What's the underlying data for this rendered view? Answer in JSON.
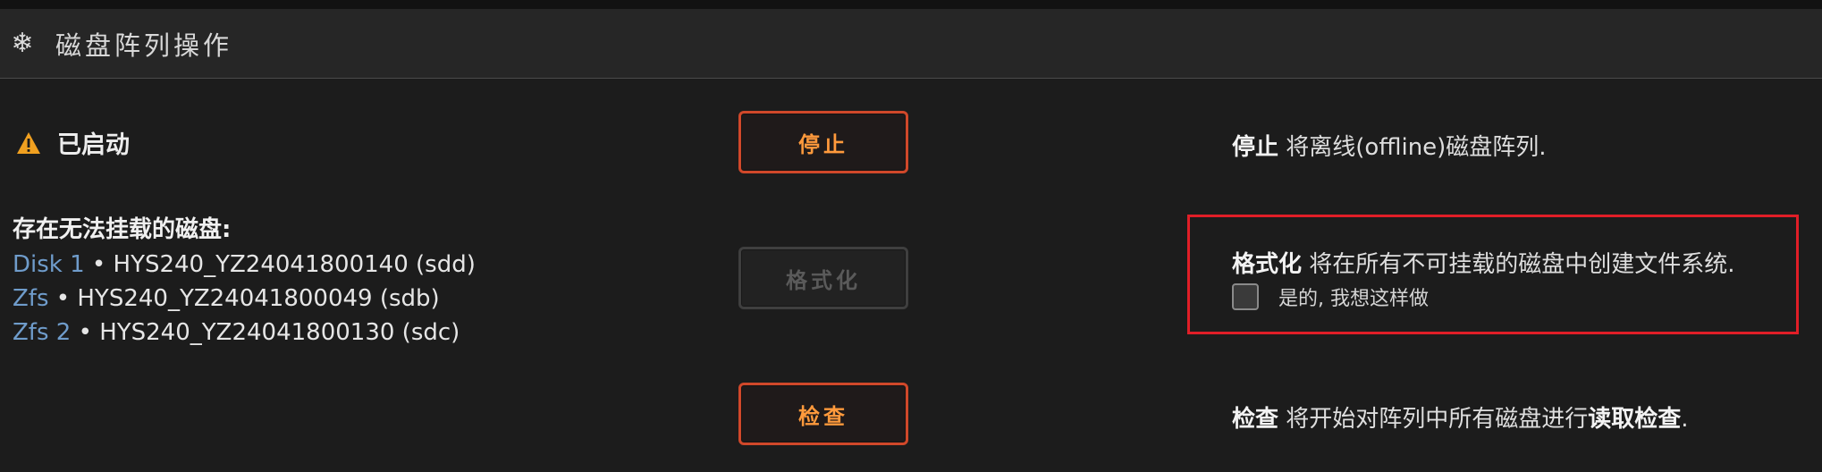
{
  "header": {
    "title": "磁盘阵列操作",
    "icon": "snowflake-icon"
  },
  "status": {
    "icon": "warning-icon",
    "text": "已启动",
    "icon_color": "#f0a020"
  },
  "buttons": {
    "stop": "停止",
    "format": "格式化",
    "check": "检查"
  },
  "descriptions": {
    "stop": {
      "bold": "停止",
      "text": " 将离线(offline)磁盘阵列."
    },
    "format": {
      "bold": "格式化",
      "text": " 将在所有不可挂载的磁盘中创建文件系统."
    },
    "check": {
      "bold": "检查",
      "text_before": " 将开始对阵列中所有磁盘进行",
      "bold2": "读取检查",
      "text_after": "."
    }
  },
  "unmountable": {
    "title": "存在无法挂载的磁盘:",
    "disks": [
      {
        "name": "Disk 1",
        "detail": " • HYS240_YZ24041800140 (sdd)"
      },
      {
        "name": "Zfs",
        "detail": " • HYS240_YZ24041800049 (sdb)"
      },
      {
        "name": "Zfs 2",
        "detail": " • HYS240_YZ24041800130 (sdc)"
      }
    ]
  },
  "confirm": {
    "label": "是的, 我想这样做",
    "checked": false
  },
  "colors": {
    "accent_orange": "#ff9a3c",
    "button_border": "#d0482a",
    "highlight_red": "#e01e27",
    "disk_link": "#6f9ccb"
  }
}
